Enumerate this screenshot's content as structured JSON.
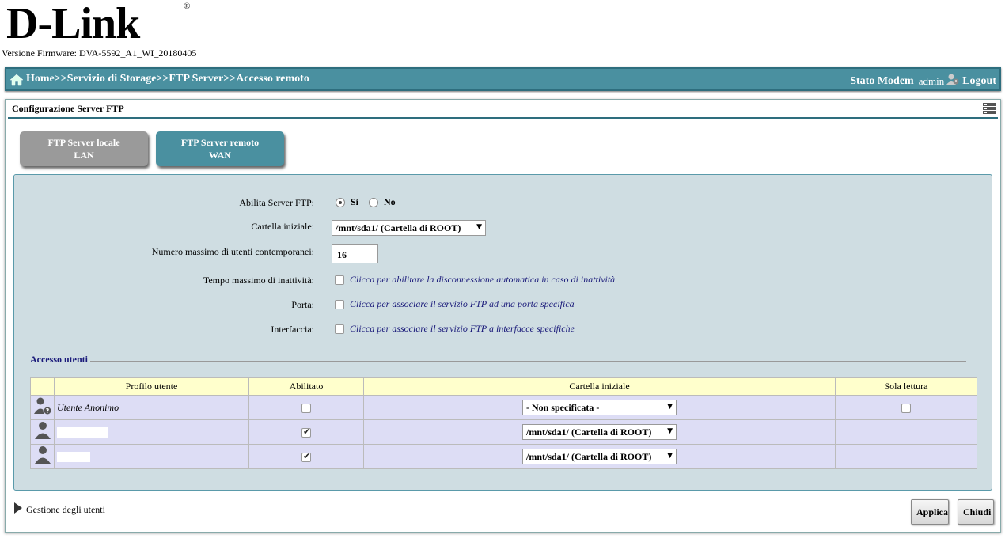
{
  "brand": {
    "logo_text": "D-Link",
    "registered": "®"
  },
  "firmware": "Versione Firmware: DVA-5592_A1_WI_20180405",
  "navbar": {
    "breadcrumb": "Home>>Servizio di Storage>>FTP Server>>Accesso remoto",
    "stato_modem": "Stato Modem",
    "user": "admin",
    "logout": "Logout"
  },
  "panel": {
    "title": "Configurazione Server FTP",
    "tabs": [
      {
        "line1": "FTP Server locale",
        "line2": "LAN"
      },
      {
        "line1": "FTP Server remoto",
        "line2": "WAN"
      }
    ]
  },
  "config": {
    "abilita_label": "Abilita Server FTP:",
    "si": "Si",
    "no": "No",
    "cartella_label": "Cartella iniziale:",
    "cartella_value": "/mnt/sda1/ (Cartella di ROOT)",
    "max_utenti_label": "Numero massimo di utenti contemporanei:",
    "max_utenti_value": "16",
    "tempo_label": "Tempo massimo di inattività:",
    "tempo_hint": "Clicca per abilitare la disconnessione automatica in caso di inattività",
    "porta_label": "Porta:",
    "porta_hint": "Clicca per associare il servizio FTP ad una porta specifica",
    "interfaccia_label": "Interfaccia:",
    "interfaccia_hint": "Clicca per associare il servizio FTP a interfacce specifiche"
  },
  "users": {
    "section_title": "Accesso utenti",
    "headers": [
      "Profilo utente",
      "Abilitato",
      "Cartella iniziale",
      "Sola lettura"
    ],
    "rows": [
      {
        "name": "Utente Anonimo",
        "enabled": false,
        "folder": "- Non specificata -",
        "readonly": false
      },
      {
        "name": "",
        "enabled": true,
        "folder": "/mnt/sda1/ (Cartella di ROOT)"
      },
      {
        "name": "",
        "enabled": true,
        "folder": "/mnt/sda1/ (Cartella di ROOT)"
      }
    ]
  },
  "footer": {
    "gestione": "Gestione degli utenti",
    "applica": "Applica",
    "chiudi": "Chiudi"
  },
  "colors": {
    "accent": "#4a90a0",
    "tab_inactive": "#9a9a9a",
    "config_bg": "#cfdde2",
    "header_bg": "#ffffcc",
    "row_bg": "#ddddf5",
    "hint": "#1a1a7a"
  }
}
